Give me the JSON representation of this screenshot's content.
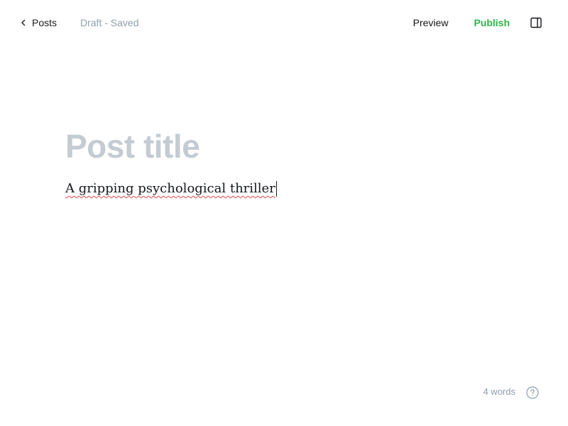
{
  "header": {
    "back_label": "Posts",
    "status": "Draft - Saved",
    "preview_label": "Preview",
    "publish_label": "Publish"
  },
  "editor": {
    "title_placeholder": "Post title",
    "body_text": "A gripping psychological thriller"
  },
  "footer": {
    "word_count": "4 words"
  },
  "icons": {
    "back": "chevron-left-icon",
    "sidebar": "sidebar-toggle-icon",
    "help": "question-circle-icon"
  },
  "colors": {
    "accent_publish": "#30b34a",
    "muted_text": "#8e9cac",
    "title_placeholder": "#c5cbd2",
    "spellcheck_underline": "#e04848"
  }
}
